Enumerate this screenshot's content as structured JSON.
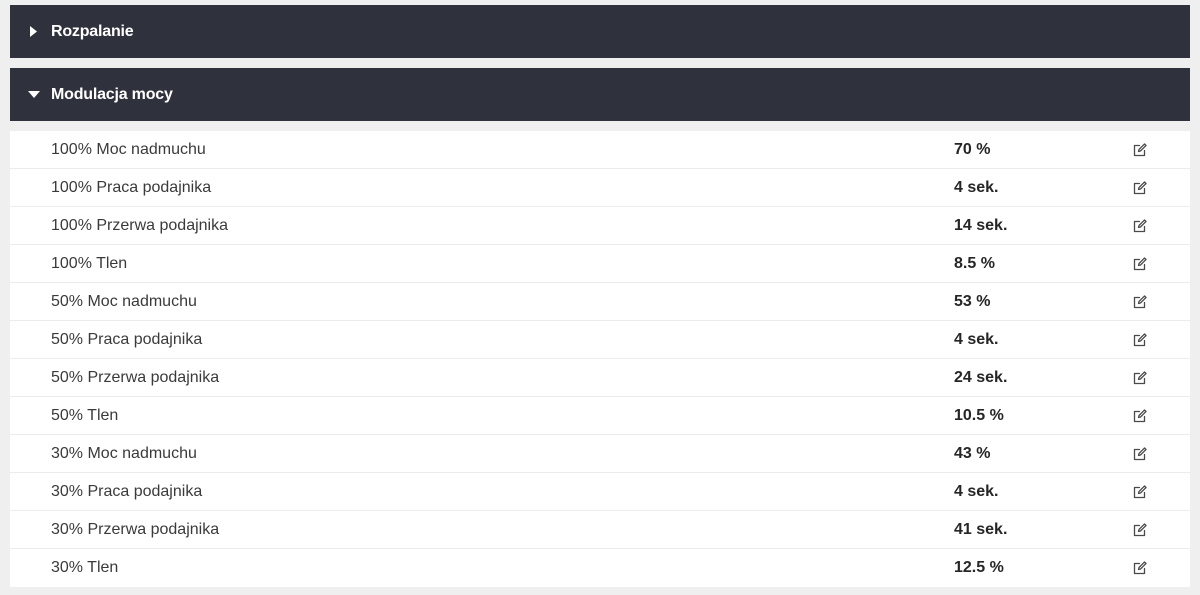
{
  "sections": [
    {
      "title": "Rozpalanie",
      "expanded": false
    },
    {
      "title": "Modulacja mocy",
      "expanded": true
    }
  ],
  "settings": [
    {
      "label": "100% Moc nadmuchu",
      "value": "70 %"
    },
    {
      "label": "100% Praca podajnika",
      "value": "4 sek."
    },
    {
      "label": "100% Przerwa podajnika",
      "value": "14 sek."
    },
    {
      "label": "100% Tlen",
      "value": "8.5 %"
    },
    {
      "label": "50% Moc nadmuchu",
      "value": "53 %"
    },
    {
      "label": "50% Praca podajnika",
      "value": "4 sek."
    },
    {
      "label": "50% Przerwa podajnika",
      "value": "24 sek."
    },
    {
      "label": "50% Tlen",
      "value": "10.5 %"
    },
    {
      "label": "30% Moc nadmuchu",
      "value": "43 %"
    },
    {
      "label": "30% Praca podajnika",
      "value": "4 sek."
    },
    {
      "label": "30% Przerwa podajnika",
      "value": "41 sek."
    },
    {
      "label": "30% Tlen",
      "value": "12.5 %"
    }
  ],
  "icons": {
    "collapsed_caret": "caret-right-icon",
    "expanded_caret": "caret-down-icon",
    "edit": "edit-icon"
  },
  "colors": {
    "header_bg": "#2f323d",
    "header_text": "#ffffff",
    "page_bg": "#efefef",
    "row_bg": "#ffffff"
  }
}
